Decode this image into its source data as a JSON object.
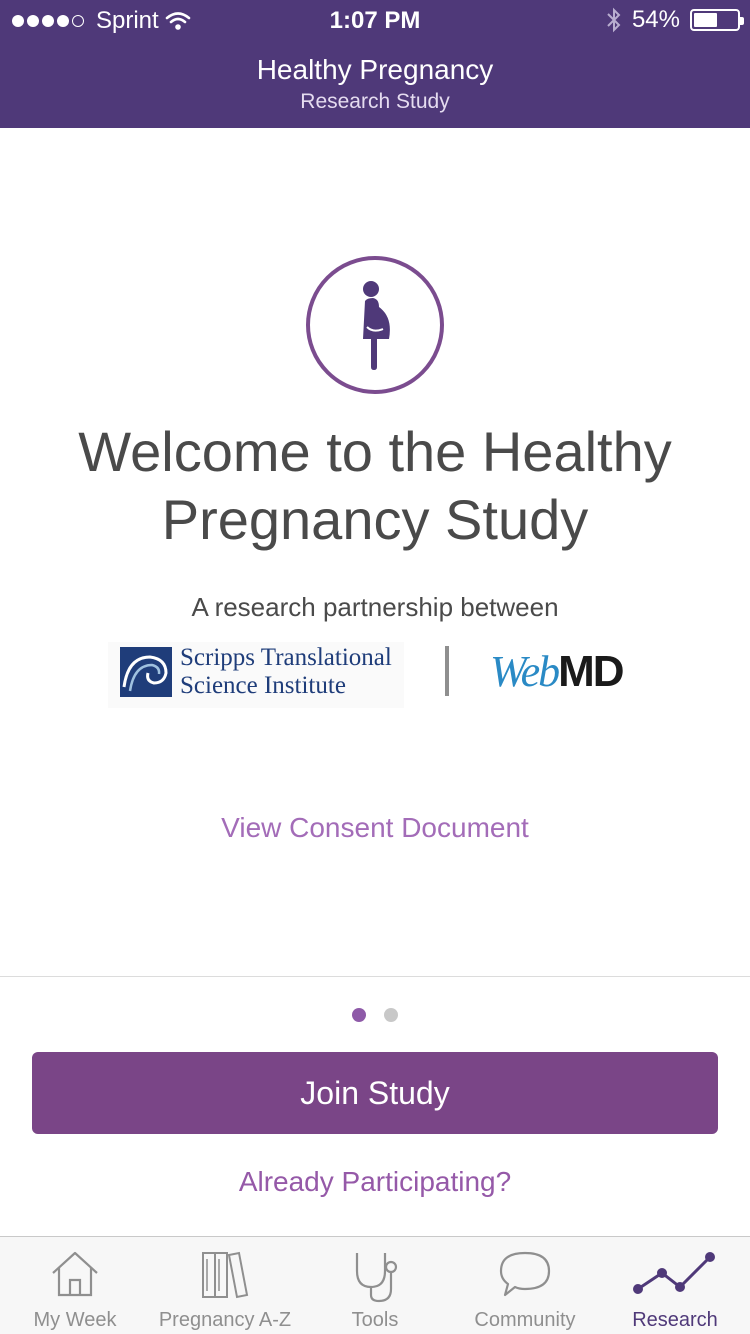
{
  "status_bar": {
    "carrier": "Sprint",
    "time": "1:07 PM",
    "battery": "54%",
    "battery_level": 0.54,
    "signal_bars": 4,
    "signal_bars_max": 5
  },
  "header": {
    "title": "Healthy Pregnancy",
    "subtitle": "Research Study"
  },
  "main": {
    "icon": "pregnant-woman-icon",
    "welcome": "Welcome to the Healthy Pregnancy Study",
    "partnership_text": "A research partnership between",
    "partners": {
      "scripps_line1": "Scripps Translational",
      "scripps_line2": "Science Institute",
      "webmd_web": "Web",
      "webmd_md": "MD"
    },
    "consent_link": "View Consent Document"
  },
  "pager": {
    "current": 1,
    "total": 2
  },
  "actions": {
    "join_label": "Join Study",
    "already_label": "Already Participating?"
  },
  "tabs": [
    {
      "label": "My Week",
      "icon": "house-icon"
    },
    {
      "label": "Pregnancy A-Z",
      "icon": "books-icon"
    },
    {
      "label": "Tools",
      "icon": "stethoscope-icon"
    },
    {
      "label": "Community",
      "icon": "speech-bubble-icon"
    },
    {
      "label": "Research",
      "icon": "trend-line-icon"
    }
  ],
  "active_tab": "Research",
  "colors": {
    "header": "#4f3979",
    "accent": "#7a4587",
    "link": "#a36cb8"
  }
}
